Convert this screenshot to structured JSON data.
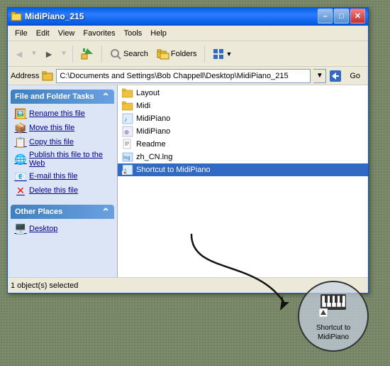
{
  "window": {
    "title": "MidiPiano_215",
    "titlebar_icon": "📁"
  },
  "titlebar_buttons": {
    "minimize": "–",
    "maximize": "□",
    "close": "✕"
  },
  "menubar": {
    "items": [
      "File",
      "Edit",
      "View",
      "Favorites",
      "Tools",
      "Help"
    ]
  },
  "toolbar": {
    "back_label": "Back",
    "search_label": "Search",
    "folders_label": "Folders"
  },
  "addressbar": {
    "label": "Address",
    "path": "C:\\Documents and Settings\\Bob Chappell\\Desktop\\MidiPiano_215",
    "go_label": "Go",
    "go_arrow": "→"
  },
  "left_panel": {
    "tasks_header": "File and Folder Tasks",
    "tasks": [
      {
        "icon": "🖼️",
        "label": "Rename this file"
      },
      {
        "icon": "📦",
        "label": "Move this file"
      },
      {
        "icon": "📋",
        "label": "Copy this file"
      },
      {
        "icon": "🌐",
        "label": "Publish this file to the Web"
      },
      {
        "icon": "📧",
        "label": "E-mail this file"
      },
      {
        "icon": "❌",
        "label": "Delete this file"
      }
    ],
    "other_header": "Other Places",
    "other_places": [
      {
        "icon": "🖥️",
        "label": "Desktop"
      }
    ]
  },
  "files": [
    {
      "icon": "📁",
      "name": "Layout",
      "selected": false
    },
    {
      "icon": "📁",
      "name": "Midi",
      "selected": false
    },
    {
      "icon": "🎹",
      "name": "MidiPiano",
      "selected": false
    },
    {
      "icon": "⚙️",
      "name": "MidiPiano",
      "selected": false
    },
    {
      "icon": "📄",
      "name": "Readme",
      "selected": false
    },
    {
      "icon": "🌐",
      "name": "zh_CN.lng",
      "selected": false
    },
    {
      "icon": "🔗",
      "name": "Shortcut to MidiPiano",
      "selected": true
    }
  ],
  "shortcut": {
    "icon": "🎹",
    "label": "Shortcut to\nMidiPiano"
  },
  "statusbar": {
    "items_label": "1 object(s) selected"
  }
}
